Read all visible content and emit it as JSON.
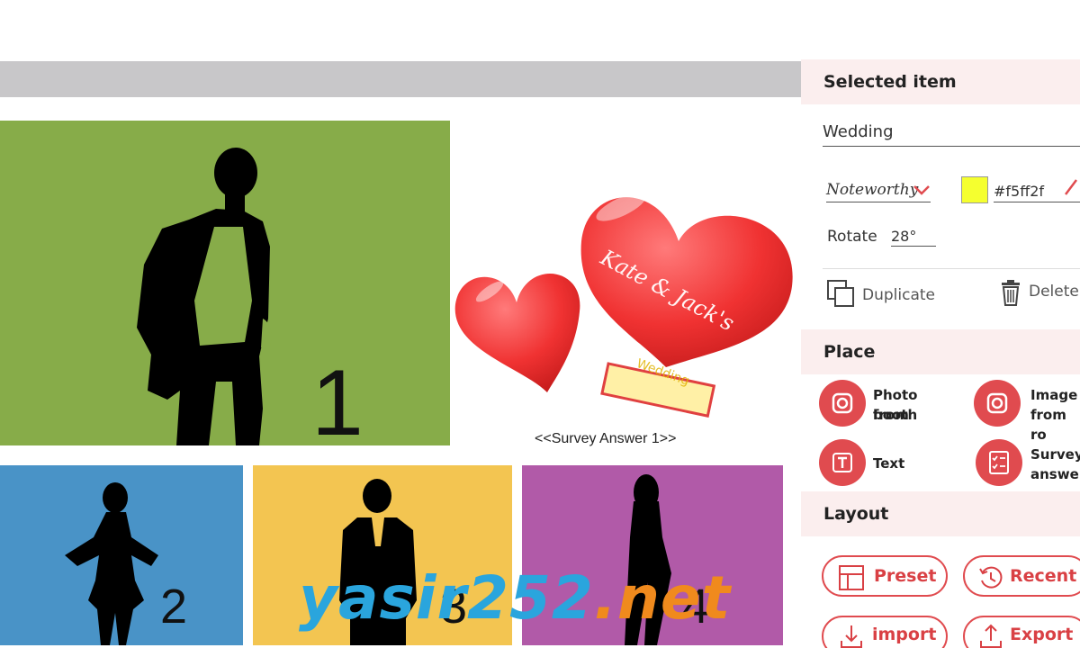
{
  "canvas": {
    "tiles": [
      {
        "number": "1",
        "color": "#87ac49"
      },
      {
        "number": "2",
        "color": "#4993c7"
      },
      {
        "number": "3",
        "color": "#f3c551"
      },
      {
        "number": "4",
        "color": "#b15aa8"
      }
    ],
    "hearts_text": "Kate & Jack's",
    "banner_text": "Wedding",
    "survey_caption": "<<Survey Answer 1>>"
  },
  "watermark": {
    "part1": "yasir252",
    "part2": ".net"
  },
  "panel": {
    "selected": {
      "title": "Selected item",
      "text_value": "Wedding",
      "font": "Noteworthy",
      "color_hex": "#f5ff2f",
      "swatch_color": "#f5ff2f",
      "rotate_label": "Rotate",
      "rotate_value": "28°",
      "duplicate_label": "Duplicate",
      "delete_label": "Delete"
    },
    "place": {
      "title": "Place",
      "items": [
        {
          "label_l1": "Photo from",
          "label_l2": "booth",
          "icon": "camera-icon"
        },
        {
          "label_l1": "Image",
          "label_l2": "from ro",
          "icon": "camera-icon"
        },
        {
          "label_l1": "Text",
          "label_l2": "",
          "icon": "text-icon"
        },
        {
          "label_l1": "Survey",
          "label_l2": "answer",
          "icon": "checklist-icon"
        }
      ]
    },
    "layout": {
      "title": "Layout",
      "preset_label": "Preset",
      "recent_label": "Recent",
      "import_label": "import",
      "export_label": "Export"
    }
  },
  "colors": {
    "accent": "#e04b4f"
  }
}
